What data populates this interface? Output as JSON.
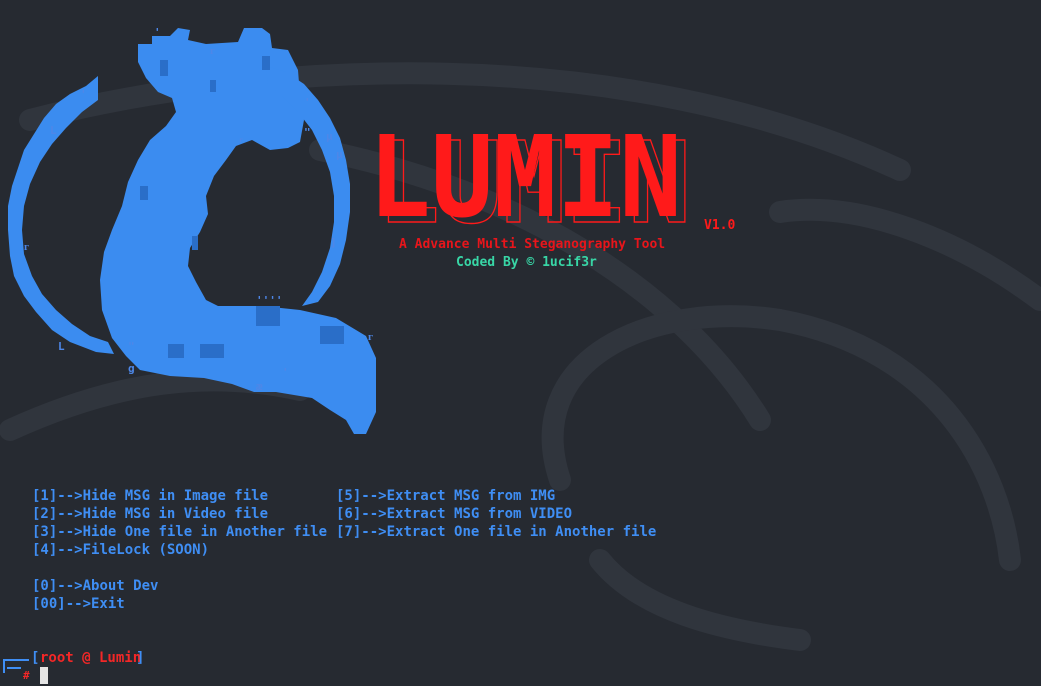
{
  "colors": {
    "background": "#262a31",
    "logo_blue": "#3b8cf0",
    "menu_blue": "#3f8ef4",
    "title_red": "#ff1a1a",
    "credit_green": "#38d6a6",
    "prompt_red": "#f42727"
  },
  "banner": {
    "title": "LUMIN",
    "version": "V1.0",
    "tagline": "A Advance Multi Steganography Tool",
    "credit": "Coded By © 1ucif3r"
  },
  "menu": {
    "items": [
      {
        "key": "[1]",
        "label": "-->Hide MSG in Image file"
      },
      {
        "key": "[2]",
        "label": "-->Hide MSG in Video file"
      },
      {
        "key": "[3]",
        "label": "-->Hide One file in Another file"
      },
      {
        "key": "[4]",
        "label": "-->FileLock (SOON)"
      },
      {
        "key": "[5]",
        "label": "-->Extract MSG from IMG"
      },
      {
        "key": "[6]",
        "label": "-->Extract MSG from VIDEO"
      },
      {
        "key": "[7]",
        "label": "-->Extract One file in Another file"
      },
      {
        "key": "[0]",
        "label": "-->About Dev"
      },
      {
        "key": "[00]",
        "label": "-->Exit"
      }
    ]
  },
  "prompt": {
    "open": "[",
    "text": "root @ Lumin",
    "close": "]",
    "symbol": "#"
  },
  "logo": {
    "icon": "dragon-ascii-icon",
    "glyphs": [
      "'",
      "ᴦ",
      "'",
      "'",
      "L",
      "\"",
      "μ",
      "μ",
      "ᵣ",
      "]",
      "ᴦ",
      "''''",
      "ᴦ",
      "L",
      "\"",
      "g",
      "æ",
      "'"
    ]
  },
  "icons": {
    "background": "kali-dragon-icon",
    "prompt_corner": "prompt-corner-icon",
    "cursor": "cursor-icon"
  }
}
